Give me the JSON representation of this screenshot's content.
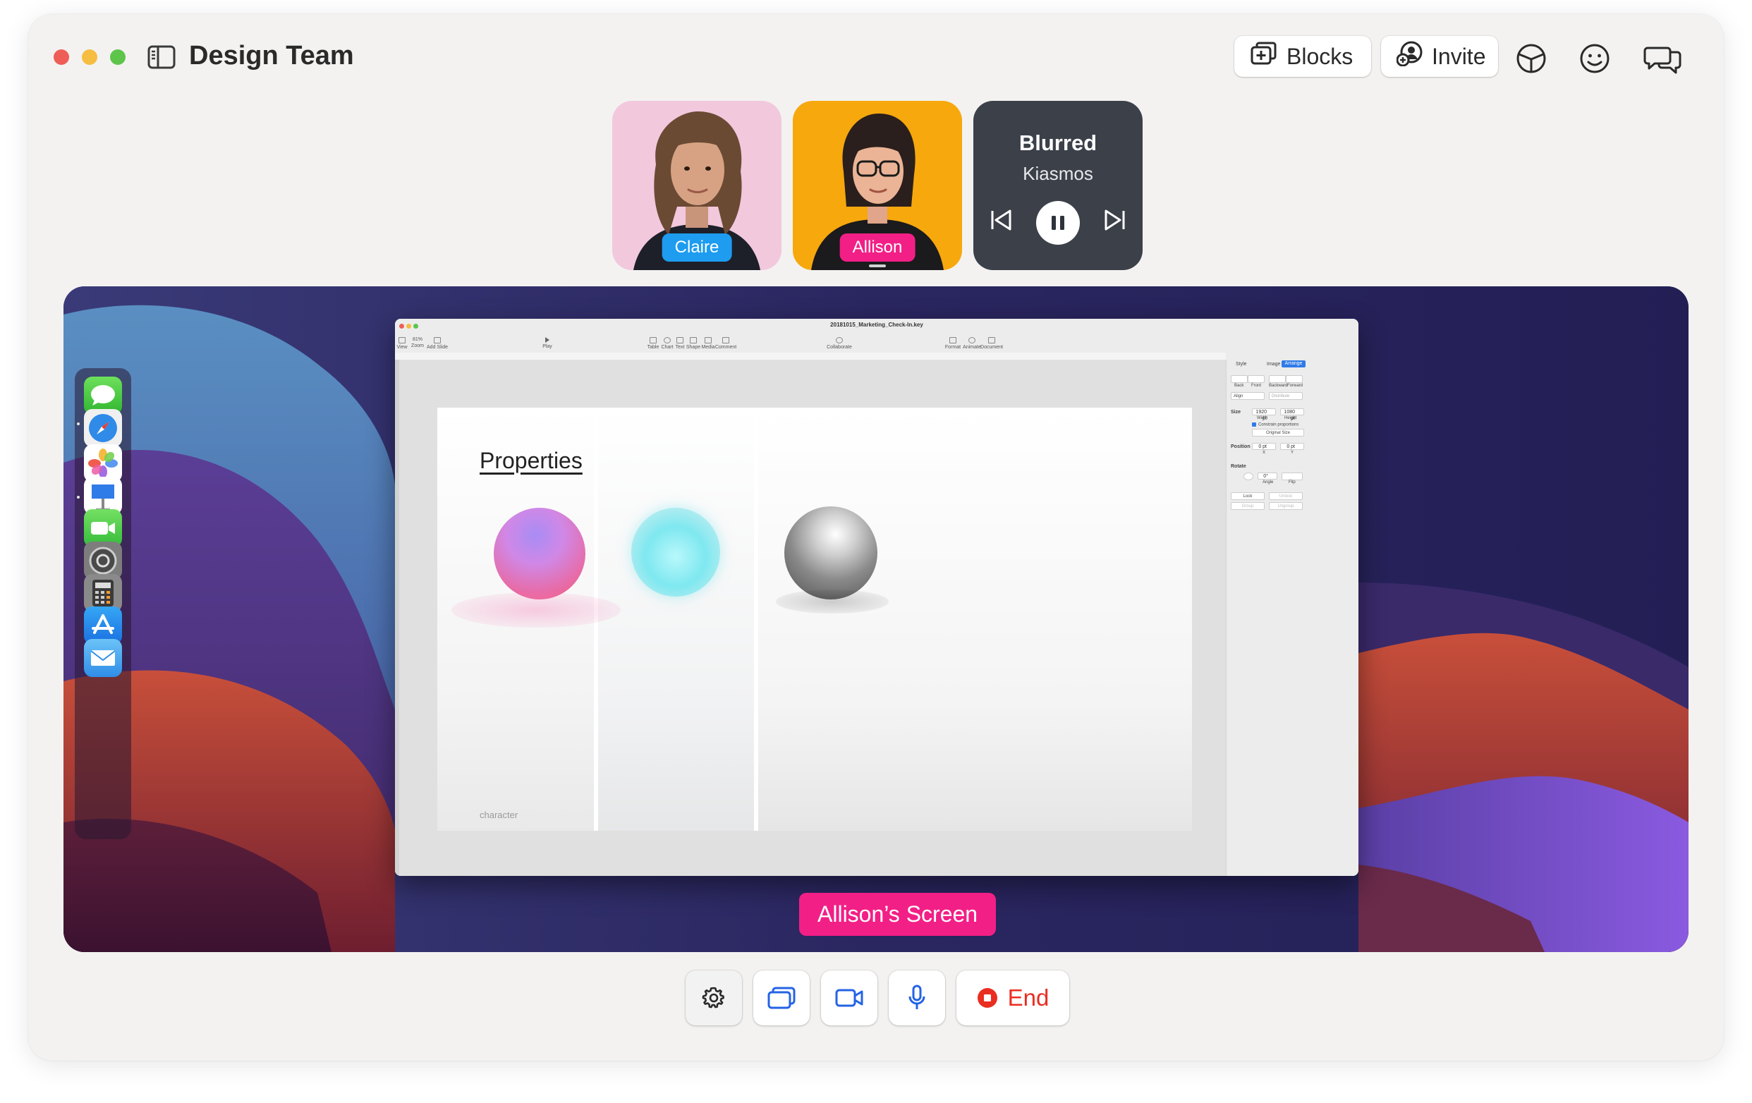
{
  "window": {
    "title": "Design Team"
  },
  "toolbar": {
    "blocks_label": "Blocks",
    "invite_label": "Invite",
    "icons": [
      "sidebar-toggle-icon",
      "blocks-icon",
      "invite-icon",
      "shared-canvas-icon",
      "emoji-icon",
      "chat-icon"
    ]
  },
  "participants": [
    {
      "name": "Claire",
      "tag_color": "#1d9cf0"
    },
    {
      "name": "Allison",
      "tag_color": "#f21f86"
    }
  ],
  "now_playing": {
    "title": "Blurred",
    "artist": "Kiasmos",
    "state": "playing"
  },
  "shared_screen": {
    "label": "Allison’s Screen",
    "dock_apps": [
      "messages-app-icon",
      "safari-app-icon",
      "photos-app-icon",
      "keynote-app-icon",
      "facetime-app-icon",
      "system-preferences-app-icon",
      "calculator-app-icon",
      "app-store-app-icon",
      "mail-app-icon"
    ],
    "keynote": {
      "filename": "20181015_Marketing_Check-In.key",
      "toolbar": {
        "view": "View",
        "zoom_value": "81%",
        "zoom": "Zoom",
        "add_slide": "Add Slide",
        "play": "Play",
        "table": "Table",
        "chart": "Chart",
        "text": "Text",
        "shape": "Shape",
        "media": "Media",
        "comment": "Comment",
        "collaborate": "Collaborate",
        "format": "Format",
        "animate": "Animate",
        "document": "Document"
      },
      "inspector": {
        "tabs": [
          "Style",
          "Image",
          "Arrange"
        ],
        "active_tab": "Arrange",
        "layer_buttons": [
          "Back",
          "Front",
          "Backward",
          "Forward"
        ],
        "align": "Align",
        "distribute": "Distribute",
        "size_label": "Size",
        "width_value": "1920 pt",
        "height_value": "1080 pt",
        "width_label": "Width",
        "height_label": "Height",
        "constrain": "Constrain proportions",
        "original_size": "Original Size",
        "position_label": "Position",
        "x_value": "0 pt",
        "y_value": "0 pt",
        "x_label": "X",
        "y_label": "Y",
        "rotate_label": "Rotate",
        "angle_value": "0°",
        "angle_label": "Angle",
        "flip_label": "Flip",
        "lock": "Lock",
        "unlock": "Unlock",
        "group": "Group",
        "ungroup": "Ungroup"
      },
      "slide": {
        "title": "Properties",
        "footer": "character"
      }
    }
  },
  "call_controls": {
    "end_label": "End",
    "end_color": "#ea2d21"
  }
}
